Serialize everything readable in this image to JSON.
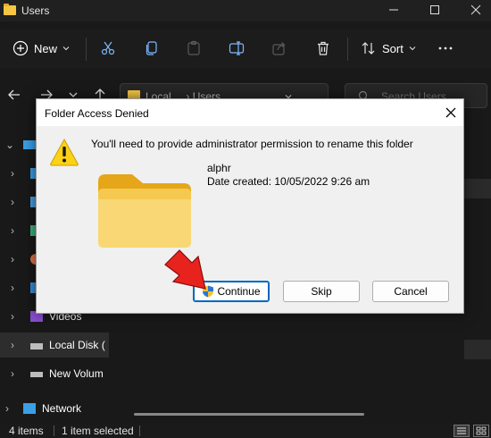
{
  "window": {
    "title": "Users"
  },
  "toolbar": {
    "new_label": "New",
    "sort_label": "Sort"
  },
  "address": {
    "crumbs": "Local ...  ›  Users"
  },
  "search": {
    "placeholder": "Search Users"
  },
  "sidebar": {
    "items": [
      {
        "label": "Videos",
        "icon": "videos-icon"
      },
      {
        "label": "Local Disk (",
        "icon": "drive-icon"
      },
      {
        "label": "New Volum",
        "icon": "drive-icon"
      },
      {
        "label": "Network",
        "icon": "network-icon"
      }
    ]
  },
  "status": {
    "items_count": "4 items",
    "selected": "1 item selected"
  },
  "dialog": {
    "title": "Folder Access Denied",
    "message": "You'll need to provide administrator permission to rename this folder",
    "file_name": "alphr",
    "date_created": "Date created: 10/05/2022 9:26 am",
    "continue_label": "Continue",
    "skip_label": "Skip",
    "cancel_label": "Cancel"
  },
  "colors": {
    "accent": "#0067c0",
    "folder": "#f5c642",
    "warning": "#fcd116",
    "annotation_arrow": "#e8231d"
  }
}
